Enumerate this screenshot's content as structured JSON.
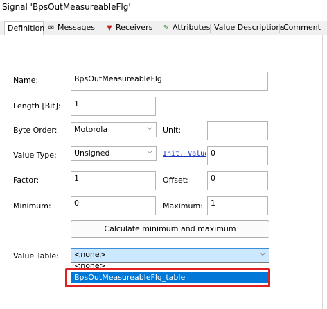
{
  "window": {
    "title": "Signal 'BpsOutMeasureableFlg'"
  },
  "tabs": [
    {
      "label": "Definition",
      "icon": ""
    },
    {
      "label": "Messages",
      "icon": "envelope-icon"
    },
    {
      "label": "Receivers",
      "icon": "receiver-icon"
    },
    {
      "label": "Attributes",
      "icon": "pencil-icon"
    },
    {
      "label": "Value Descriptions",
      "icon": ""
    },
    {
      "label": "Comment",
      "icon": ""
    }
  ],
  "form": {
    "name_label": "Name:",
    "name_value": "BpsOutMeasureableFlg",
    "length_label": "Length [Bit]:",
    "length_value": "1",
    "byte_order_label": "Byte Order:",
    "byte_order_value": "Motorola",
    "unit_label": "Unit:",
    "unit_value": "",
    "value_type_label": "Value Type:",
    "value_type_value": "Unsigned",
    "init_value_label": "Init. Value",
    "init_value_value": "0",
    "factor_label": "Factor:",
    "factor_value": "1",
    "offset_label": "Offset:",
    "offset_value": "0",
    "minimum_label": "Minimum:",
    "minimum_value": "0",
    "maximum_label": "Maximum:",
    "maximum_value": "1",
    "calc_button": "Calculate minimum and maximum",
    "value_table_label": "Value Table:",
    "value_table_value": "<none>",
    "dropdown_options": [
      "<none>",
      "BpsOutMeasureableFlg_table"
    ],
    "selected_option": "BpsOutMeasureableFlg_table"
  },
  "colors": {
    "highlight_border": "#e02020",
    "selection": "#0078d7",
    "link": "#1a33c8"
  }
}
